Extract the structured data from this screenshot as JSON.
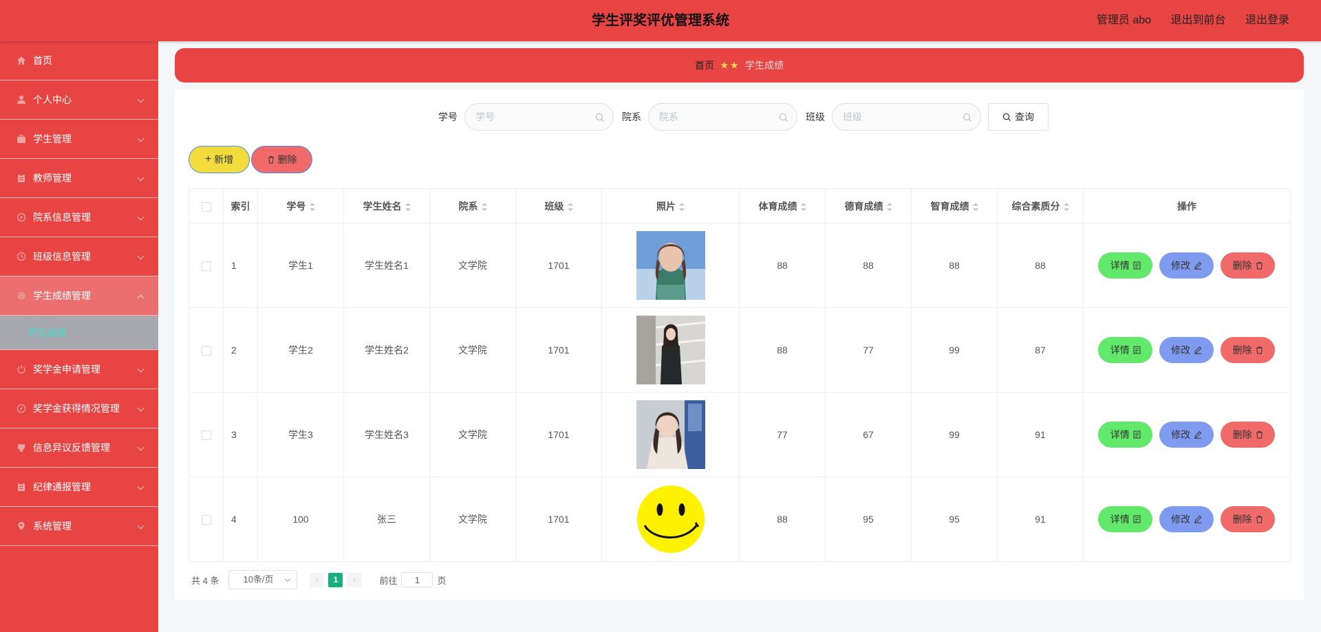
{
  "header": {
    "title": "学生评奖评优管理系统",
    "role": "管理员 abo",
    "to_frontend": "退出到前台",
    "logout": "退出登录"
  },
  "sidebar": {
    "items": [
      {
        "label": "首页",
        "icon": "home-icon"
      },
      {
        "label": "个人中心",
        "icon": "user-icon"
      },
      {
        "label": "学生管理",
        "icon": "briefcase-icon"
      },
      {
        "label": "教师管理",
        "icon": "clipboard-icon"
      },
      {
        "label": "院系信息管理",
        "icon": "compass-icon"
      },
      {
        "label": "班级信息管理",
        "icon": "clock-icon"
      },
      {
        "label": "学生成绩管理",
        "icon": "gear-icon"
      },
      {
        "label": "奖学金申请管理",
        "icon": "power-icon"
      },
      {
        "label": "奖学金获得情况管理",
        "icon": "compass-icon"
      },
      {
        "label": "信息异议反馈管理",
        "icon": "cup-icon"
      },
      {
        "label": "纪律通报管理",
        "icon": "clipboard-icon"
      },
      {
        "label": "系统管理",
        "icon": "location-icon"
      }
    ],
    "submenu_label": "学生成绩"
  },
  "breadcrumb": {
    "home": "首页",
    "current": "学生成绩"
  },
  "search": {
    "fields": [
      {
        "label": "学号",
        "placeholder": "学号"
      },
      {
        "label": "院系",
        "placeholder": "院系"
      },
      {
        "label": "班级",
        "placeholder": "班级"
      }
    ],
    "query_label": "查询"
  },
  "toolbar": {
    "add_label": "新增",
    "delete_label": "删除"
  },
  "table": {
    "headers": [
      "索引",
      "学号",
      "学生姓名",
      "院系",
      "班级",
      "照片",
      "体育成绩",
      "德育成绩",
      "智育成绩",
      "综合素质分",
      "操作"
    ],
    "rows": [
      {
        "index": "1",
        "student_id": "学生1",
        "name": "学生姓名1",
        "dept": "文学院",
        "class": "1701",
        "photo": "portrait-sky",
        "pe": "88",
        "moral": "88",
        "intellect": "88",
        "overall": "88"
      },
      {
        "index": "2",
        "student_id": "学生2",
        "name": "学生姓名2",
        "dept": "文学院",
        "class": "1701",
        "photo": "portrait-stairs",
        "pe": "88",
        "moral": "77",
        "intellect": "99",
        "overall": "87"
      },
      {
        "index": "3",
        "student_id": "学生3",
        "name": "学生姓名3",
        "dept": "文学院",
        "class": "1701",
        "photo": "portrait-indoor",
        "pe": "77",
        "moral": "67",
        "intellect": "99",
        "overall": "91"
      },
      {
        "index": "4",
        "student_id": "100",
        "name": "张三",
        "dept": "文学院",
        "class": "1701",
        "photo": "smiley-face",
        "pe": "88",
        "moral": "95",
        "intellect": "95",
        "overall": "91"
      }
    ],
    "op_detail": "详情",
    "op_edit": "修改",
    "op_delete": "删除"
  },
  "pagination": {
    "total": "共 4 条",
    "page_size": "10条/页",
    "current_page": "1",
    "goto_label": "前往",
    "goto_value": "1",
    "page_suffix": "页"
  }
}
